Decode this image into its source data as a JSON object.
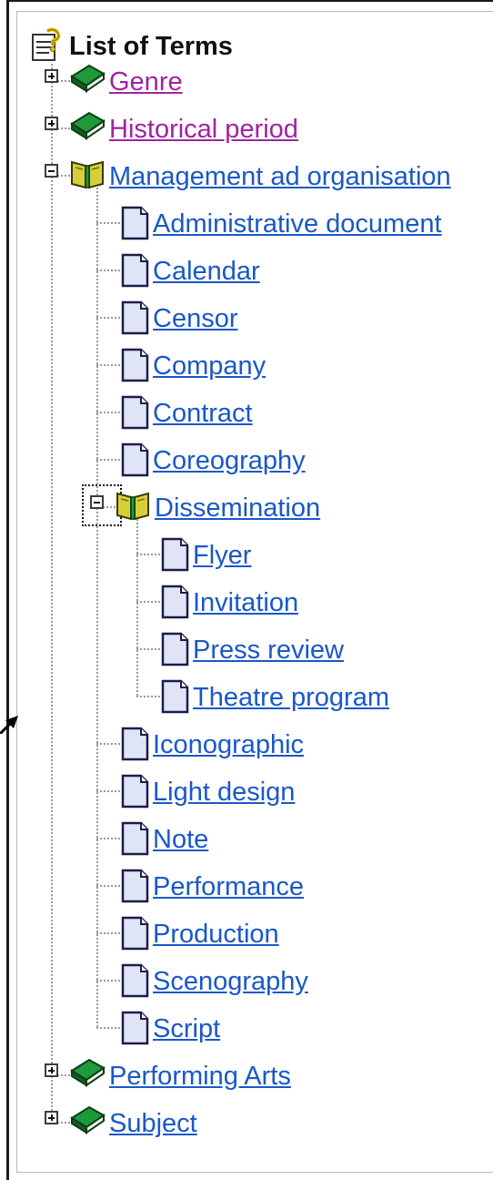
{
  "tree": {
    "root_label": "List of Terms",
    "nodes": [
      {
        "label": "Genre",
        "state": "visited"
      },
      {
        "label": "Historical period",
        "state": "visited"
      },
      {
        "label": "Management ad organisation",
        "state": "link"
      },
      {
        "label": "Administrative document",
        "state": "link"
      },
      {
        "label": "Calendar",
        "state": "link"
      },
      {
        "label": "Censor",
        "state": "link"
      },
      {
        "label": "Company",
        "state": "link"
      },
      {
        "label": "Contract",
        "state": "link"
      },
      {
        "label": "Coreography",
        "state": "link"
      },
      {
        "label": "Dissemination",
        "state": "link"
      },
      {
        "label": "Flyer",
        "state": "link"
      },
      {
        "label": "Invitation",
        "state": "link"
      },
      {
        "label": "Press review",
        "state": "link"
      },
      {
        "label": "Theatre program",
        "state": "link"
      },
      {
        "label": "Iconographic",
        "state": "link"
      },
      {
        "label": "Light design",
        "state": "link"
      },
      {
        "label": "Note",
        "state": "link"
      },
      {
        "label": "Performance",
        "state": "link"
      },
      {
        "label": "Production",
        "state": "link"
      },
      {
        "label": "Scenography",
        "state": "link"
      },
      {
        "label": "Script",
        "state": "link"
      },
      {
        "label": "Performing Arts",
        "state": "link"
      },
      {
        "label": "Subject",
        "state": "link"
      }
    ]
  },
  "icons": {
    "root": "notes-icon",
    "collapsed_branch": "closed-book-icon",
    "expanded_branch": "open-book-icon",
    "leaf": "document-icon"
  },
  "colors": {
    "visited_link": "#a023a0",
    "link": "#1958c8",
    "closed_book": "#1e9a3a",
    "open_book": "#d7cf3a",
    "document": "#dfe4f7"
  }
}
